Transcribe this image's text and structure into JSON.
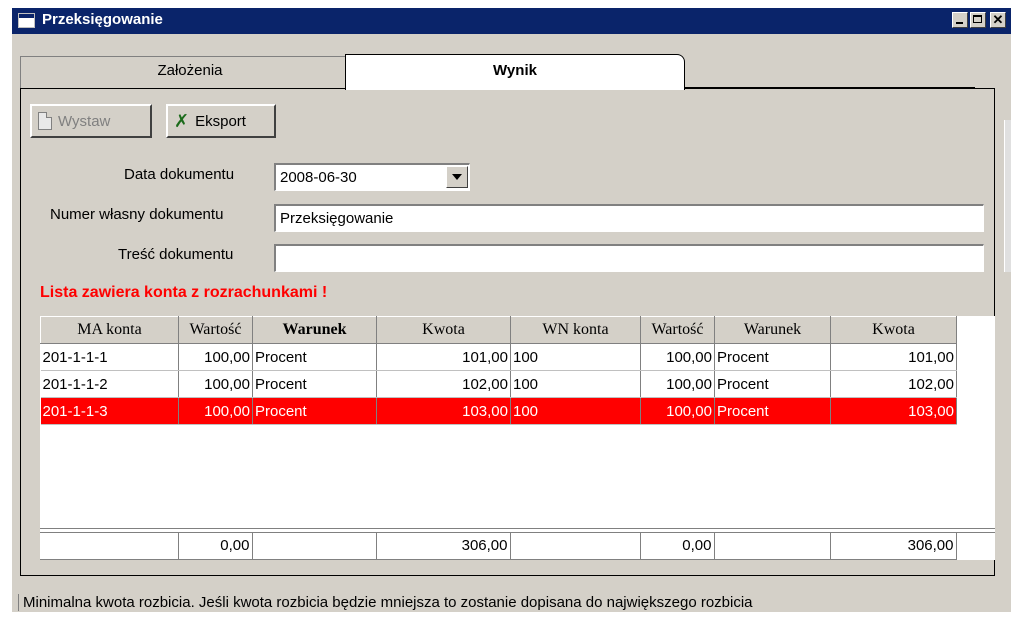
{
  "window": {
    "title": "Przeksięgowanie"
  },
  "tabs": [
    {
      "label": "Założenia",
      "active": false
    },
    {
      "label": "Wynik",
      "active": true
    }
  ],
  "toolbar": {
    "wystaw_label": "Wystaw",
    "eksport_label": "Eksport"
  },
  "form": {
    "data_label": "Data dokumentu",
    "data_value": "2008-06-30",
    "numer_label": "Numer własny dokumentu",
    "numer_value": "Przeksięgowanie",
    "tresc_label": "Treść dokumentu",
    "tresc_value": ""
  },
  "warning": "Lista zawiera konta z rozrachunkami !",
  "grid": {
    "columns": [
      "MA konta",
      "Wartość",
      "Warunek",
      "Kwota",
      "WN konta",
      "Wartość",
      "Warunek",
      "Kwota"
    ],
    "rows": [
      [
        "201-1-1-1",
        "100,00",
        "Procent",
        "101,00",
        "100",
        "100,00",
        "Procent",
        "101,00"
      ],
      [
        "201-1-1-2",
        "100,00",
        "Procent",
        "102,00",
        "100",
        "100,00",
        "Procent",
        "102,00"
      ],
      [
        "201-1-1-3",
        "100,00",
        "Procent",
        "103,00",
        "100",
        "100,00",
        "Procent",
        "103,00"
      ]
    ],
    "selected_row": 2,
    "totals": [
      "",
      "0,00",
      "",
      "306,00",
      "",
      "0,00",
      "",
      "306,00"
    ]
  },
  "status": "Minimalna kwota rozbicia. Jeśli kwota rozbicia będzie mniejsza to zostanie dopisana do największego rozbicia",
  "colors": {
    "titlebar": "#0a246a",
    "selection": "#ff0000",
    "warning": "#ff0000",
    "face": "#d4d0c8"
  }
}
